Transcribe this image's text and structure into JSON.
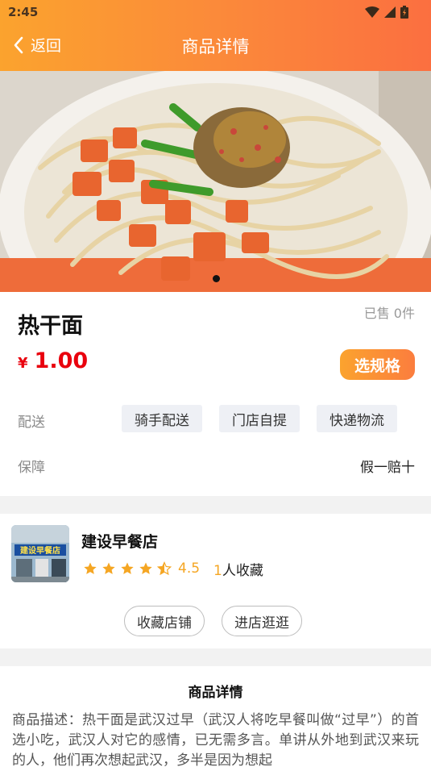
{
  "status_bar": {
    "time": "2:45",
    "icons": [
      "wifi-icon",
      "signal-icon",
      "battery-icon"
    ]
  },
  "nav": {
    "back_label": "返回",
    "title": "商品详情"
  },
  "carousel": {
    "slide_count": 1,
    "active_index": 0
  },
  "product": {
    "name": "热干面",
    "sold": "已售 0件",
    "currency": "¥",
    "price": "1.00",
    "select_spec_label": "选规格",
    "delivery_label": "配送",
    "delivery_options": [
      "骑手配送",
      "门店自提",
      "快递物流"
    ],
    "guarantee_label": "保障",
    "guarantee_value": "假一赔十"
  },
  "store": {
    "name": "建设早餐店",
    "thumb_sign_text": "建设早餐店",
    "rating": "4.5",
    "rating_stars": 4.5,
    "favorites_count": "1",
    "favorites_suffix": "人收藏",
    "favorite_store_label": "收藏店铺",
    "enter_store_label": "进店逛逛"
  },
  "detail": {
    "title": "商品详情",
    "text": "商品描述：热干面是武汉过早（武汉人将吃早餐叫做“过早”）的首选小吃，武汉人对它的感情，已无需多言。单讲从外地到武汉来玩的人，他们再次想起武汉，多半是因为想起"
  },
  "colors": {
    "header_start": "#fba32e",
    "header_end": "#fb6f40",
    "price": "#e9000d",
    "star": "#f5a623"
  }
}
